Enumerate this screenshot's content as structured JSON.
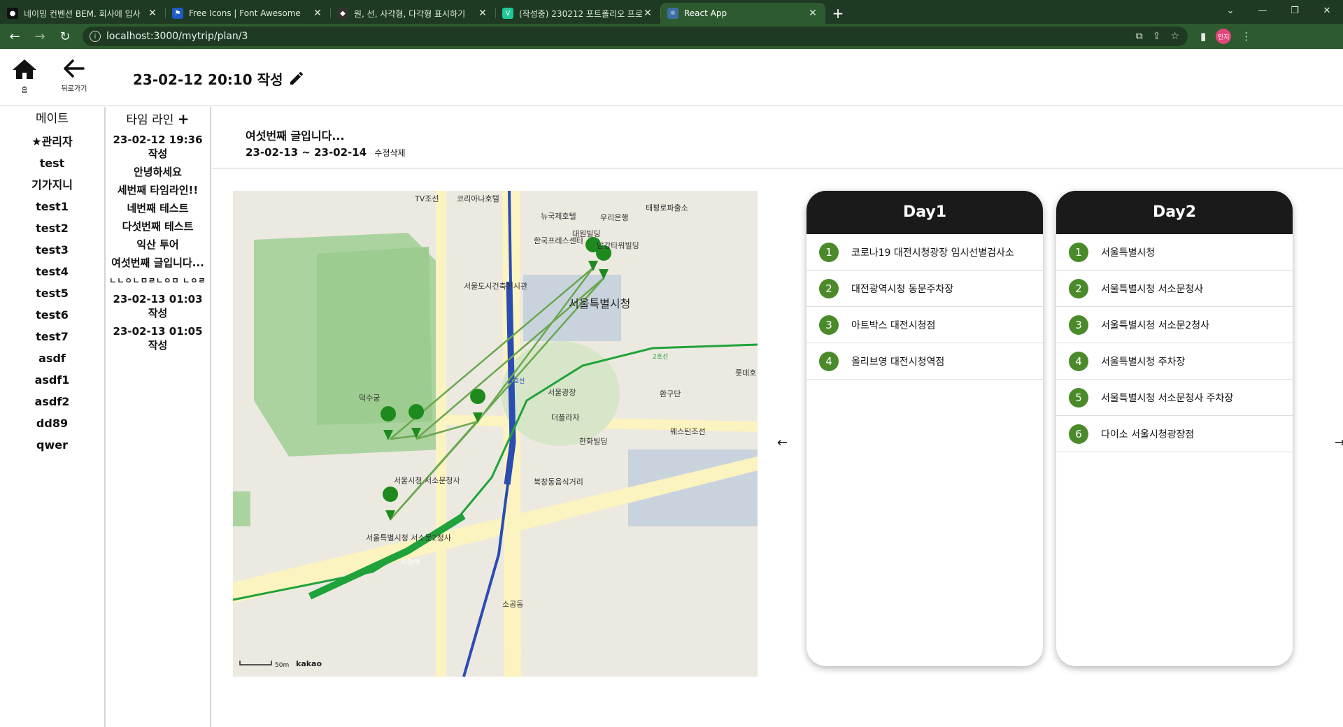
{
  "browser": {
    "tabs": [
      {
        "label": "네이밍 컨벤션 BEM. 회사에 입사",
        "fav_color": "#111111",
        "fav_glyph": "●"
      },
      {
        "label": "Free Icons | Font Awesome",
        "fav_color": "#1e5bc6",
        "fav_glyph": "⚑"
      },
      {
        "label": "원, 선, 사각형, 다각형 표시하기",
        "fav_color": "#333333",
        "fav_glyph": "◆"
      },
      {
        "label": "(작성중) 230212 포트폴리오 프로",
        "fav_color": "#20c997",
        "fav_glyph": "V"
      },
      {
        "label": "React App",
        "fav_color": "#3a6ea5",
        "fav_glyph": "⚛"
      }
    ],
    "active_tab": 4,
    "url": "localhost:3000/mytrip/plan/3",
    "profile": "민지"
  },
  "header": {
    "home_label": "홈",
    "back_label": "뒤로가기",
    "title": "23-02-12 20:10 작성"
  },
  "mates": {
    "header": "메이트",
    "admin": "관리자",
    "items": [
      "test",
      "기가지니",
      "test1",
      "test2",
      "test3",
      "test4",
      "test5",
      "test6",
      "test7",
      "asdf",
      "asdf1",
      "asdf2",
      "dd89",
      "qwer"
    ]
  },
  "timeline": {
    "header": "타임 라인",
    "items": [
      "23-02-12 19:36 작성",
      "안녕하세요",
      "세번째 타임라인!!",
      "네번째 테스트",
      "다섯번째 테스트",
      "익산 투어",
      "여섯번째 글입니다...",
      "ㄴㄴㅇㄴㅁㄹㄴㅇㅁ ㄴㅇㄹ",
      "23-02-13 01:03 작성",
      "23-02-13 01:05 작성"
    ]
  },
  "plan": {
    "title": "여섯번째 글입니다...",
    "dates": "23-02-13 ~ 23-02-14",
    "edit_label": "수정",
    "delete_label": "삭제"
  },
  "map": {
    "labels": {
      "city_hall": "서울특별시청",
      "deoksugung": "덕수궁",
      "seoul_plaza": "서울광장",
      "tv": "TV조선",
      "koreana": "코리아나호텔",
      "newspress": "뉴국제호텔",
      "woori": "우리은행",
      "taepyeong": "태평로파출소",
      "press": "한국프레스센터",
      "daewon": "대원빌딩",
      "namgang": "남강타워빌딩",
      "city_lib": "서울도시건축전시관",
      "seosomun": "서울시청 서소문청사",
      "seosomun2": "서울특별시청 서소문2청사",
      "plaza_hotel": "더플라자",
      "hanwha": "한화빌딩",
      "westin": "웨스틴조선",
      "lotte": "롯데호",
      "hwangudan": "환구단",
      "kakao": "kakao",
      "scale": "50m",
      "sogong": "소공동",
      "bukchang": "북창동음식거리",
      "seoul_station_line": "1호선",
      "line2": "2호선",
      "sicheong_stn": "시청역"
    },
    "colors": {
      "route": "#6aa84f",
      "subway1": "#2b4cb3",
      "subway2": "#1fa23a",
      "marker": "#1e8a1e",
      "park": "#aad3a0",
      "road": "#fbf3c0"
    }
  },
  "days": [
    {
      "title": "Day1",
      "places": [
        "코로나19 대전시청광장 임시선별검사소",
        "대전광역시청 동문주차장",
        "아트박스 대전시청점",
        "올리브영 대전시청역점"
      ]
    },
    {
      "title": "Day2",
      "places": [
        "서울특별시청",
        "서울특별시청 서소문청사",
        "서울특별시청 서소문2청사",
        "서울특별시청 주차장",
        "서울특별시청 서소문청사 주차장",
        "다이소 서울시청광장점"
      ]
    }
  ],
  "nav": {
    "prev": "←",
    "next": "→"
  }
}
